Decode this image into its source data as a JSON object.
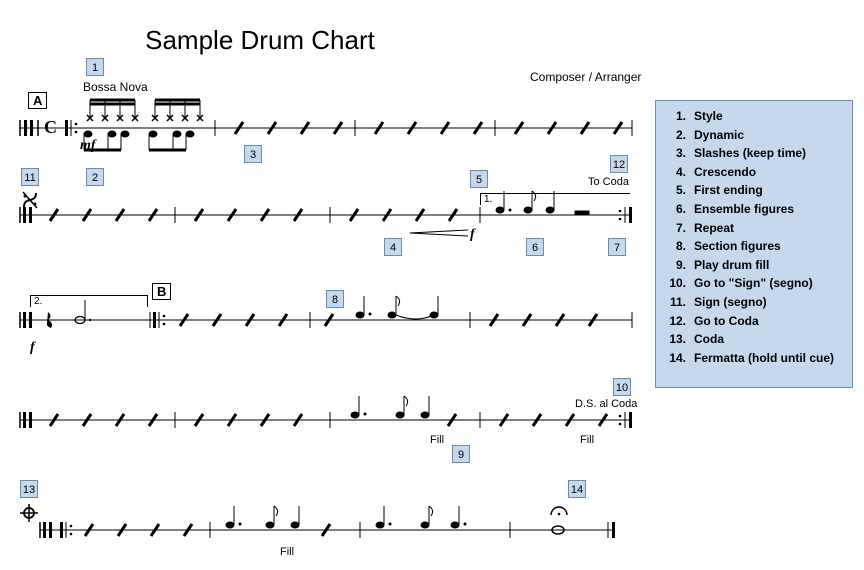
{
  "title": "Sample Drum Chart",
  "credit": "Composer / Arranger",
  "style": "Bossa Nova",
  "to_coda": "To Coda",
  "ds_al_coda": "D.S. al Coda",
  "fill": "Fill",
  "dyn_mf": "mf",
  "dyn_f": "f",
  "rehearsal_a": "A",
  "rehearsal_b": "B",
  "volta1": "1.",
  "volta2": "2.",
  "callouts": {
    "c1": "1",
    "c2": "2",
    "c3": "3",
    "c4": "4",
    "c5": "5",
    "c6": "6",
    "c7": "7",
    "c8": "8",
    "c9": "9",
    "c10": "10",
    "c11": "11",
    "c12": "12",
    "c13": "13",
    "c14": "14"
  },
  "legend": [
    {
      "n": "1.",
      "t": "Style"
    },
    {
      "n": "2.",
      "t": "Dynamic"
    },
    {
      "n": "3.",
      "t": "Slashes (keep time)"
    },
    {
      "n": "4.",
      "t": "Crescendo"
    },
    {
      "n": "5.",
      "t": "First ending"
    },
    {
      "n": "6.",
      "t": "Ensemble figures"
    },
    {
      "n": "7.",
      "t": "Repeat"
    },
    {
      "n": "8.",
      "t": "Section figures"
    },
    {
      "n": "9.",
      "t": "Play drum fill"
    },
    {
      "n": "10.",
      "t": "Go to \"Sign\" (segno)"
    },
    {
      "n": "11.",
      "t": "Sign (segno)"
    },
    {
      "n": "12.",
      "t": "Go to Coda"
    },
    {
      "n": "13.",
      "t": "Coda"
    },
    {
      "n": "14.",
      "t": "Fermatta (hold until cue)"
    }
  ]
}
